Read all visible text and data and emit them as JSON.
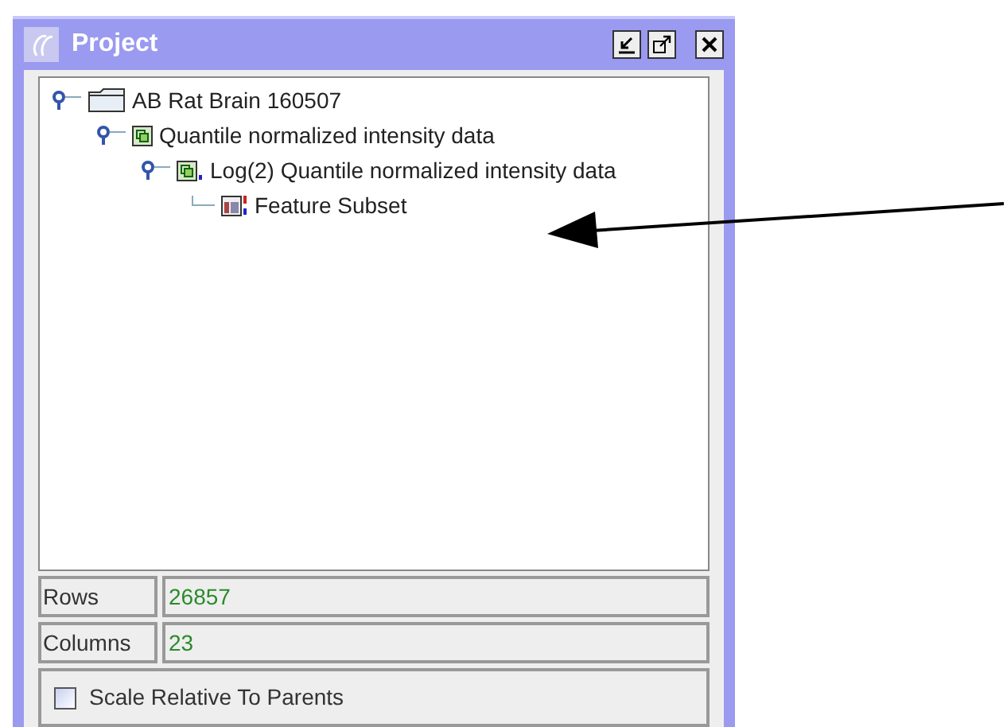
{
  "window": {
    "title": "Project"
  },
  "tree": [
    {
      "label": "AB Rat Brain 160507",
      "kind": "folder",
      "expanded": true,
      "children": [
        {
          "label": "Quantile normalized intensity data",
          "kind": "dataset",
          "expanded": true,
          "children": [
            {
              "label": "Log(2) Quantile normalized intensity data",
              "kind": "log-dataset",
              "expanded": true,
              "children": [
                {
                  "label": "Feature Subset",
                  "kind": "subset"
                }
              ]
            }
          ]
        }
      ]
    }
  ],
  "properties": [
    {
      "label": "Rows",
      "value": "26857"
    },
    {
      "label": "Columns",
      "value": "23"
    }
  ],
  "scale_option": {
    "label": "Scale Relative To Parents",
    "checked": false
  }
}
